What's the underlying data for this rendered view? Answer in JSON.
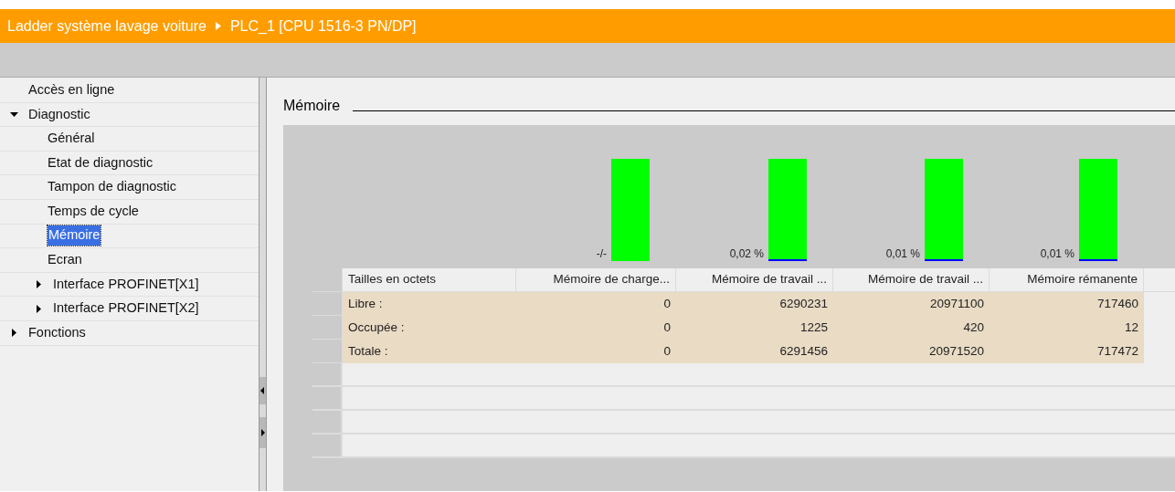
{
  "title_bar": {
    "project": "Ladder système lavage voiture",
    "device": "PLC_1 [CPU 1516-3 PN/DP]"
  },
  "sidebar": {
    "items": [
      {
        "label": "Accès en ligne",
        "selected": false
      },
      {
        "label": "Diagnostic",
        "selected": false,
        "expanded": true,
        "children": [
          {
            "label": "Général",
            "selected": false
          },
          {
            "label": "Etat de diagnostic",
            "selected": false
          },
          {
            "label": "Tampon de diagnostic",
            "selected": false
          },
          {
            "label": "Temps de cycle",
            "selected": false
          },
          {
            "label": "Mémoire",
            "selected": true
          },
          {
            "label": "Ecran",
            "selected": false
          },
          {
            "label": "Interface PROFINET[X1]",
            "selected": false,
            "expanded": false
          },
          {
            "label": "Interface PROFINET[X2]",
            "selected": false,
            "expanded": false
          }
        ]
      },
      {
        "label": "Fonctions",
        "selected": false,
        "expanded": false
      }
    ]
  },
  "section": {
    "title": "Mémoire"
  },
  "gauges": [
    {
      "label": "-/-"
    },
    {
      "label": "0,02 %",
      "level": 0.0002
    },
    {
      "label": "0,01 %",
      "level": 0.0001
    },
    {
      "label": "0,01 %",
      "level": 0.0001
    }
  ],
  "table": {
    "columns": [
      "Tailles en octets",
      "Mémoire de charge...",
      "Mémoire de travail ...",
      "Mémoire de travail ...",
      "Mémoire rémanente"
    ],
    "rows": [
      {
        "cells": [
          "Libre :",
          "0",
          "6290231",
          "20971100",
          "717460"
        ]
      },
      {
        "cells": [
          "Occupée :",
          "0",
          "1225",
          "420",
          "12"
        ]
      },
      {
        "cells": [
          "Totale :",
          "0",
          "6291456",
          "20971520",
          "717472"
        ]
      }
    ]
  }
}
